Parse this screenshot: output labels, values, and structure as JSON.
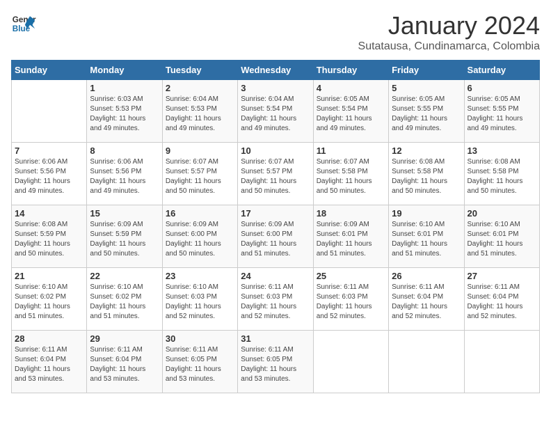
{
  "logo": {
    "line1": "General",
    "line2": "Blue"
  },
  "title": "January 2024",
  "subtitle": "Sutatausa, Cundinamarca, Colombia",
  "days_of_week": [
    "Sunday",
    "Monday",
    "Tuesday",
    "Wednesday",
    "Thursday",
    "Friday",
    "Saturday"
  ],
  "weeks": [
    [
      {
        "day": "",
        "info": ""
      },
      {
        "day": "1",
        "info": "Sunrise: 6:03 AM\nSunset: 5:53 PM\nDaylight: 11 hours\nand 49 minutes."
      },
      {
        "day": "2",
        "info": "Sunrise: 6:04 AM\nSunset: 5:53 PM\nDaylight: 11 hours\nand 49 minutes."
      },
      {
        "day": "3",
        "info": "Sunrise: 6:04 AM\nSunset: 5:54 PM\nDaylight: 11 hours\nand 49 minutes."
      },
      {
        "day": "4",
        "info": "Sunrise: 6:05 AM\nSunset: 5:54 PM\nDaylight: 11 hours\nand 49 minutes."
      },
      {
        "day": "5",
        "info": "Sunrise: 6:05 AM\nSunset: 5:55 PM\nDaylight: 11 hours\nand 49 minutes."
      },
      {
        "day": "6",
        "info": "Sunrise: 6:05 AM\nSunset: 5:55 PM\nDaylight: 11 hours\nand 49 minutes."
      }
    ],
    [
      {
        "day": "7",
        "info": "Sunrise: 6:06 AM\nSunset: 5:56 PM\nDaylight: 11 hours\nand 49 minutes."
      },
      {
        "day": "8",
        "info": "Sunrise: 6:06 AM\nSunset: 5:56 PM\nDaylight: 11 hours\nand 49 minutes."
      },
      {
        "day": "9",
        "info": "Sunrise: 6:07 AM\nSunset: 5:57 PM\nDaylight: 11 hours\nand 50 minutes."
      },
      {
        "day": "10",
        "info": "Sunrise: 6:07 AM\nSunset: 5:57 PM\nDaylight: 11 hours\nand 50 minutes."
      },
      {
        "day": "11",
        "info": "Sunrise: 6:07 AM\nSunset: 5:58 PM\nDaylight: 11 hours\nand 50 minutes."
      },
      {
        "day": "12",
        "info": "Sunrise: 6:08 AM\nSunset: 5:58 PM\nDaylight: 11 hours\nand 50 minutes."
      },
      {
        "day": "13",
        "info": "Sunrise: 6:08 AM\nSunset: 5:58 PM\nDaylight: 11 hours\nand 50 minutes."
      }
    ],
    [
      {
        "day": "14",
        "info": "Sunrise: 6:08 AM\nSunset: 5:59 PM\nDaylight: 11 hours\nand 50 minutes."
      },
      {
        "day": "15",
        "info": "Sunrise: 6:09 AM\nSunset: 5:59 PM\nDaylight: 11 hours\nand 50 minutes."
      },
      {
        "day": "16",
        "info": "Sunrise: 6:09 AM\nSunset: 6:00 PM\nDaylight: 11 hours\nand 50 minutes."
      },
      {
        "day": "17",
        "info": "Sunrise: 6:09 AM\nSunset: 6:00 PM\nDaylight: 11 hours\nand 51 minutes."
      },
      {
        "day": "18",
        "info": "Sunrise: 6:09 AM\nSunset: 6:01 PM\nDaylight: 11 hours\nand 51 minutes."
      },
      {
        "day": "19",
        "info": "Sunrise: 6:10 AM\nSunset: 6:01 PM\nDaylight: 11 hours\nand 51 minutes."
      },
      {
        "day": "20",
        "info": "Sunrise: 6:10 AM\nSunset: 6:01 PM\nDaylight: 11 hours\nand 51 minutes."
      }
    ],
    [
      {
        "day": "21",
        "info": "Sunrise: 6:10 AM\nSunset: 6:02 PM\nDaylight: 11 hours\nand 51 minutes."
      },
      {
        "day": "22",
        "info": "Sunrise: 6:10 AM\nSunset: 6:02 PM\nDaylight: 11 hours\nand 51 minutes."
      },
      {
        "day": "23",
        "info": "Sunrise: 6:10 AM\nSunset: 6:03 PM\nDaylight: 11 hours\nand 52 minutes."
      },
      {
        "day": "24",
        "info": "Sunrise: 6:11 AM\nSunset: 6:03 PM\nDaylight: 11 hours\nand 52 minutes."
      },
      {
        "day": "25",
        "info": "Sunrise: 6:11 AM\nSunset: 6:03 PM\nDaylight: 11 hours\nand 52 minutes."
      },
      {
        "day": "26",
        "info": "Sunrise: 6:11 AM\nSunset: 6:04 PM\nDaylight: 11 hours\nand 52 minutes."
      },
      {
        "day": "27",
        "info": "Sunrise: 6:11 AM\nSunset: 6:04 PM\nDaylight: 11 hours\nand 52 minutes."
      }
    ],
    [
      {
        "day": "28",
        "info": "Sunrise: 6:11 AM\nSunset: 6:04 PM\nDaylight: 11 hours\nand 53 minutes."
      },
      {
        "day": "29",
        "info": "Sunrise: 6:11 AM\nSunset: 6:04 PM\nDaylight: 11 hours\nand 53 minutes."
      },
      {
        "day": "30",
        "info": "Sunrise: 6:11 AM\nSunset: 6:05 PM\nDaylight: 11 hours\nand 53 minutes."
      },
      {
        "day": "31",
        "info": "Sunrise: 6:11 AM\nSunset: 6:05 PM\nDaylight: 11 hours\nand 53 minutes."
      },
      {
        "day": "",
        "info": ""
      },
      {
        "day": "",
        "info": ""
      },
      {
        "day": "",
        "info": ""
      }
    ]
  ]
}
